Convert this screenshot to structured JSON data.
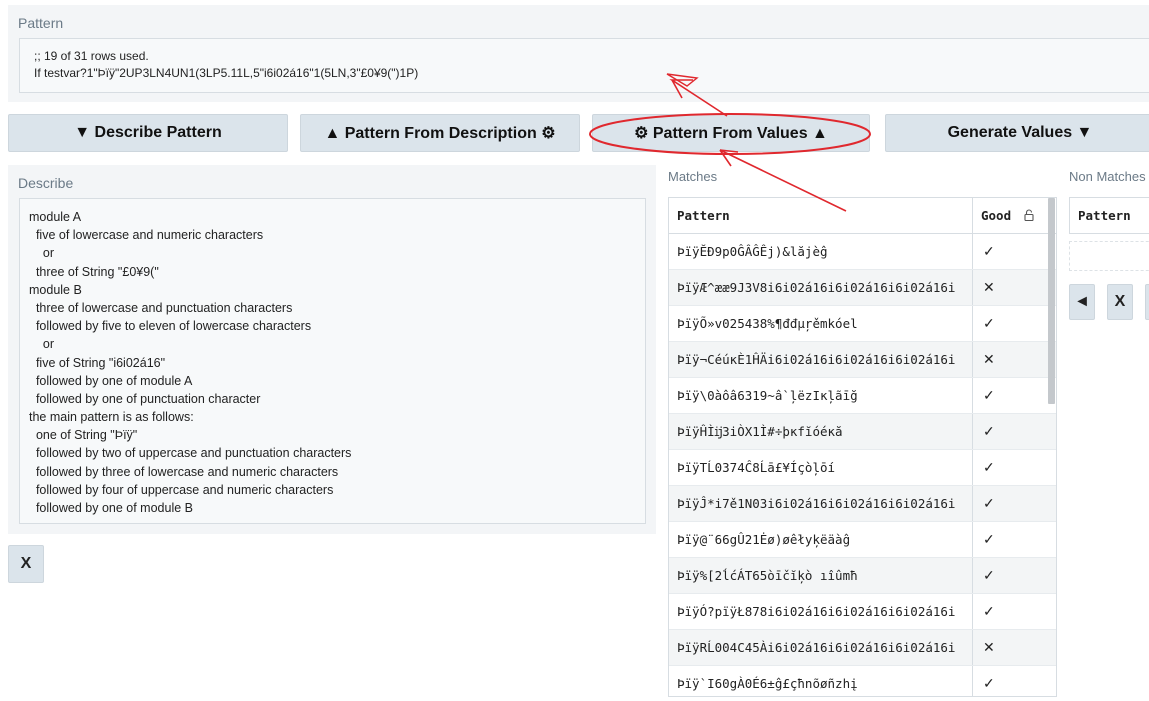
{
  "pattern": {
    "label": "Pattern",
    "line1": ";; 19 of 31 rows used.",
    "line2": "If testvar?1\"Þïÿ\"2UP3LN4UN1(3LP5.11L,5\"i6i02á16\"1(5LN,3\"£0¥9(\")1P)"
  },
  "buttons": {
    "describe": "▼ Describe Pattern",
    "from_description": "▲ Pattern From Description ⚙",
    "from_values": "⚙ Pattern From Values ▲",
    "generate": "Generate Values ▼"
  },
  "describe": {
    "label": "Describe",
    "lines": [
      "module A",
      "  five of lowercase and numeric characters",
      "    or",
      "  three of String \"£0¥9(\"",
      "module B",
      "  three of lowercase and punctuation characters",
      "  followed by five to eleven of lowercase characters",
      "    or",
      "  five of String \"i6i02á16\"",
      "  followed by one of module A",
      "  followed by one of punctuation character",
      "the main pattern is as follows:",
      "  one of String \"Þïÿ\"",
      "  followed by two of uppercase and punctuation characters",
      "  followed by three of lowercase and numeric characters",
      "  followed by four of uppercase and numeric characters",
      "  followed by one of module B"
    ]
  },
  "clear_label": "X",
  "matches": {
    "label": "Matches",
    "col_pattern": "Pattern",
    "col_good": "Good",
    "rows": [
      {
        "pattern": "ÞïÿĔÐ9p0ĜÂĜÊj)&lăjèĝ",
        "good": "✓"
      },
      {
        "pattern": "ÞïÿÆ^ææ9J3V8i6i02á16i6i02á16i6i02á16i",
        "good": "✕"
      },
      {
        "pattern": "ÞïÿÕ»v025438%¶đđµŗěmkóel",
        "good": "✓"
      },
      {
        "pattern": "Þïÿ¬CéúĸÈ1ĤÄi6i02á16i6i02á16i6i02á16i",
        "good": "✕"
      },
      {
        "pattern": "Þïÿ\\0àôâ6319~â`ļëzIĸļãīğ",
        "good": "✓"
      },
      {
        "pattern": "ÞïÿĤÌĳ3iÒX1Ì#÷þĸfĭóéĸă",
        "good": "✓"
      },
      {
        "pattern": "ÞïÿTĹ0374Ĉ8Ĺā£¥Íçòļōí",
        "good": "✓"
      },
      {
        "pattern": "ÞïÿĴ*i7ě1N03i6i02á16i6i02á16i6i02á16i",
        "good": "✓"
      },
      {
        "pattern": "Þïÿ@¨66gÛ21Ėø)øêłyķëäàĝ",
        "good": "✓"
      },
      {
        "pattern": "Þïÿ%[2ĺćÁT65òīčĭķò ıîûmħ",
        "good": "✓"
      },
      {
        "pattern": "ÞïÿÓ?pïÿŁ878i6i02á16i6i02á16i6i02á16i",
        "good": "✓"
      },
      {
        "pattern": "ÞïÿRĹ004C45Ài6i02á16i6i02á16i6i02á16i",
        "good": "✕"
      },
      {
        "pattern": "Þïÿ`I60gÀ0É6±ĝ£çħnõøñzhį",
        "good": "✓"
      }
    ]
  },
  "non_matches": {
    "label": "Non Matches",
    "col_pattern": "Pattern",
    "prev": "◄",
    "clear": "X"
  }
}
